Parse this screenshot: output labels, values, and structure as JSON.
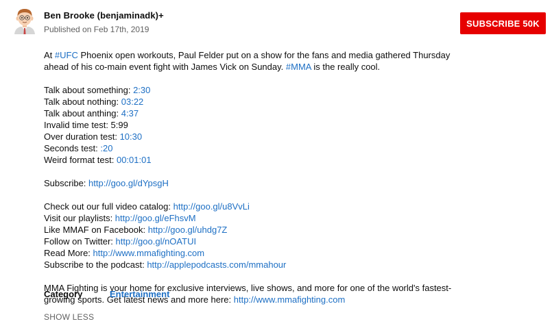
{
  "channel": {
    "name": "Ben Brooke (benjaminadk)+",
    "published": "Published on Feb 17th, 2019",
    "avatar_icon": "cartoon-avatar-icon",
    "subscribe_label": "SUBSCRIBE 50K",
    "subscribe_color": "#e60000"
  },
  "description": {
    "intro": {
      "t1": "At ",
      "tag_ufc": "#UFC",
      "t2": " Phoenix open workouts, Paul Felder put on a show for the fans and media gathered Thursday ahead of his co-main event fight with James Vick on Sunday. ",
      "tag_mma": "#MMA",
      "t3": " is the really cool."
    },
    "timestamps": [
      {
        "label": "Talk about something: ",
        "time": "2:30"
      },
      {
        "label": "Talk about nothing: ",
        "time": "03:22"
      },
      {
        "label": "Talk about anthing: ",
        "time": "4:37"
      },
      {
        "label": "Invalid time test: 5:99",
        "time": ""
      },
      {
        "label": "Over duration test: ",
        "time": "10:30"
      },
      {
        "label": "Seconds test: ",
        "time": ":20"
      },
      {
        "label": "Weird format test: ",
        "time": "00:01:01"
      }
    ],
    "subscribe_line": {
      "label": "Subscribe: ",
      "url": "http://goo.gl/dYpsgH"
    },
    "links": [
      {
        "label": "Check out our full video catalog: ",
        "url": "http://goo.gl/u8VvLi"
      },
      {
        "label": "Visit our playlists: ",
        "url": "http://goo.gl/eFhsvM"
      },
      {
        "label": "Like MMAF on Facebook: ",
        "url": "http://goo.gl/uhdg7Z"
      },
      {
        "label": "Follow on Twitter: ",
        "url": "http://goo.gl/nOATUI"
      },
      {
        "label": "Read More: ",
        "url": "http://www.mmafighting.com"
      },
      {
        "label": "Subscribe to the podcast: ",
        "url": "http://applepodcasts.com/mmahour"
      }
    ],
    "outro": {
      "text": "MMA Fighting is your home for exclusive interviews, live shows, and more for one of the world's fastest-growing sports. Get latest news and more here: ",
      "url": "http://www.mmafighting.com"
    }
  },
  "meta": {
    "category_label": "Category",
    "category_value": "Entertainment"
  },
  "show_less_label": "SHOW LESS",
  "colors": {
    "link": "#1d6fc4",
    "subscribe": "#e60000",
    "secondary_text": "#606060"
  }
}
